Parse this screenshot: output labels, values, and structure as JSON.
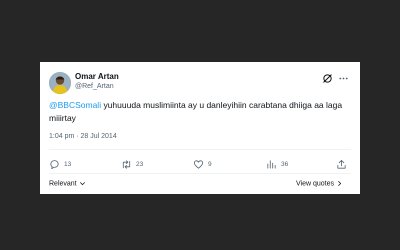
{
  "tweet": {
    "author_name": "Omar Artan",
    "author_handle": "@Ref_Artan",
    "text_mention": "@BBCSomali",
    "text_body": " yuhuuuda muslimiinta ay u danleyihiin carabtana dhiiga aa laga miiirtay",
    "timestamp": "1:04 pm · 28 Jul 2014"
  },
  "actions": {
    "replies": "13",
    "retweets": "23",
    "likes": "9",
    "views": "36"
  },
  "footer": {
    "sort_label": "Relevant",
    "view_quotes_label": "View quotes"
  },
  "colors": {
    "background": "#262626",
    "accent": "#1d9bf0",
    "text": "#0f1419",
    "muted": "#536471"
  },
  "icons": [
    "avatar",
    "grok-icon",
    "more-icon",
    "reply-icon",
    "retweet-icon",
    "like-icon",
    "views-icon",
    "share-icon",
    "chevron-down-icon",
    "chevron-right-icon"
  ]
}
